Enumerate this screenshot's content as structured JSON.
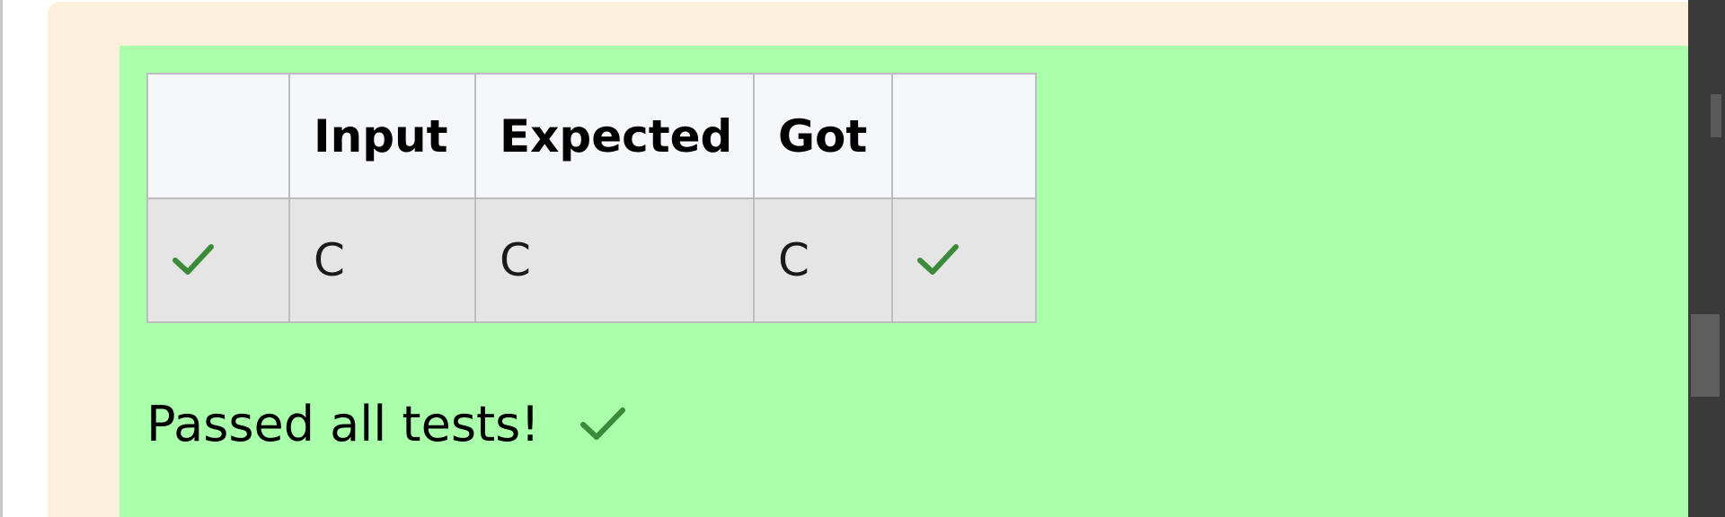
{
  "table": {
    "headers": [
      "",
      "Input",
      "Expected",
      "Got",
      ""
    ],
    "rows": [
      {
        "input": "C",
        "expected": "C",
        "got": "C",
        "status_icon": "check-icon",
        "result_icon": "check-icon"
      }
    ]
  },
  "summary": {
    "text": "Passed all tests!",
    "icon": "check-icon"
  },
  "colors": {
    "pass_background": "#aaffaa",
    "outer_background": "#fcefdc",
    "check_color": "#3a8a3a"
  }
}
